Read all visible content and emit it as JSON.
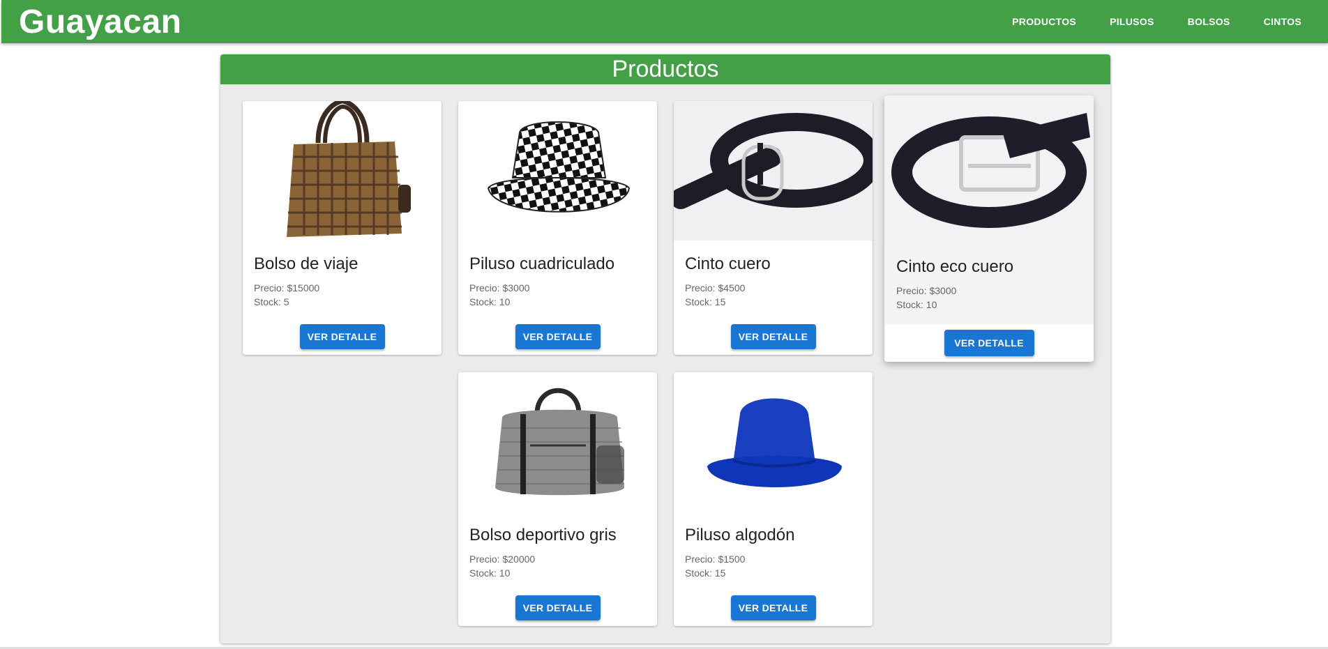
{
  "app": {
    "brand": "Guayacan"
  },
  "nav": {
    "items": [
      "PRODUCTOS",
      "PILUSOS",
      "BOLSOS",
      "CINTOS"
    ]
  },
  "panel": {
    "title": "Productos"
  },
  "products": [
    {
      "name": "Bolso de viaje",
      "price": "Precio: $15000",
      "stock": "Stock: 5",
      "button": "VER DETALLE",
      "image": "travel-bag-image"
    },
    {
      "name": "Piluso cuadriculado",
      "price": "Precio: $3000",
      "stock": "Stock: 10",
      "button": "VER DETALLE",
      "image": "checkered-hat-image"
    },
    {
      "name": "Cinto cuero",
      "price": "Precio: $4500",
      "stock": "Stock: 15",
      "button": "VER DETALLE",
      "image": "leather-belt-image"
    },
    {
      "name": "Cinto eco cuero",
      "price": "Precio: $3000",
      "stock": "Stock: 10",
      "button": "VER DETALLE",
      "image": "eco-leather-belt-image"
    },
    {
      "name": "Bolso deportivo gris",
      "price": "Precio: $20000",
      "stock": "Stock: 10",
      "button": "VER DETALLE",
      "image": "sport-bag-image"
    },
    {
      "name": "Piluso algodón",
      "price": "Precio: $1500",
      "stock": "Stock: 15",
      "button": "VER DETALLE",
      "image": "blue-hat-image"
    }
  ],
  "colors": {
    "primary": "#43a047",
    "button": "#1976d2",
    "panel": "#ebebeb"
  }
}
